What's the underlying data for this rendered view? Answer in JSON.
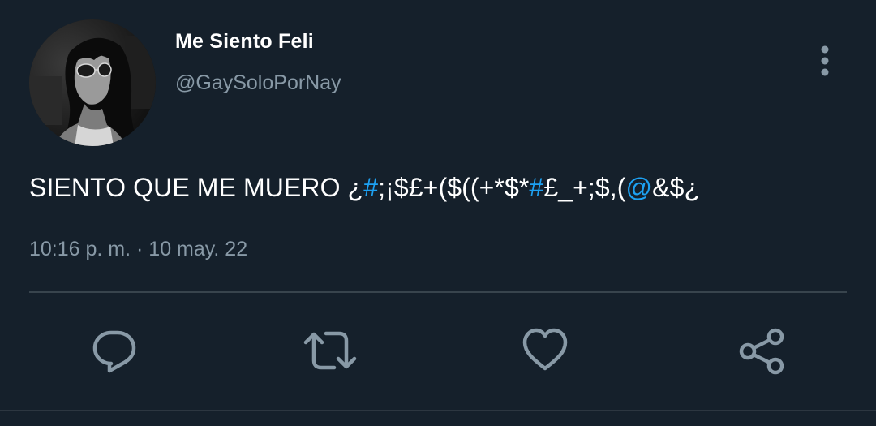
{
  "tweet": {
    "author": {
      "display_name": "Me Siento Feli",
      "handle": "@GaySoloPorNay"
    },
    "text_segments": [
      {
        "text": "SIENTO QUE ME MUERO ¿",
        "type": "text"
      },
      {
        "text": "#",
        "type": "link"
      },
      {
        "text": ";¡$£+($((+*$*",
        "type": "text"
      },
      {
        "text": "#",
        "type": "link"
      },
      {
        "text": "£_+;$,(",
        "type": "text"
      },
      {
        "text": "@",
        "type": "link"
      },
      {
        "text": "&$¿",
        "type": "text"
      }
    ],
    "timestamp": "10:16 p. m. · 10 may. 22"
  },
  "actions": [
    {
      "name": "reply-button",
      "icon": "reply-icon"
    },
    {
      "name": "retweet-button",
      "icon": "retweet-icon"
    },
    {
      "name": "like-button",
      "icon": "heart-icon"
    },
    {
      "name": "share-button",
      "icon": "share-icon"
    }
  ],
  "colors": {
    "background": "#15202b",
    "secondary_text": "#8899a6",
    "link": "#1da1f2",
    "divider": "#38444d",
    "icon": "#8899a6"
  }
}
